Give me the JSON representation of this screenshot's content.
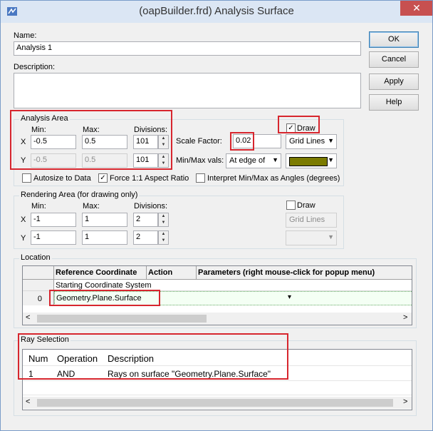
{
  "window": {
    "title": "(oapBuilder.frd) Analysis Surface",
    "close_glyph": "✕"
  },
  "name": {
    "label": "Name:",
    "value": "Analysis 1"
  },
  "description": {
    "label": "Description:",
    "value": ""
  },
  "buttons": {
    "ok": "OK",
    "cancel": "Cancel",
    "apply": "Apply",
    "help": "Help"
  },
  "analysis_area": {
    "title": "Analysis Area",
    "min_label": "Min:",
    "max_label": "Max:",
    "div_label": "Divisions:",
    "x_label": "X",
    "y_label": "Y",
    "x_min": "-0.5",
    "x_max": "0.5",
    "x_div": "101",
    "y_min": "-0.5",
    "y_max": "0.5",
    "y_div": "101",
    "draw_label": "Draw",
    "scale_label": "Scale Factor:",
    "scale_value": "0.02",
    "grid_lines": "Grid Lines",
    "minmax_label": "Min/Max vals:",
    "minmax_value": "At edge of",
    "color_swatch": "#7b7b00",
    "autosize": "Autosize to Data",
    "force_aspect": "Force 1:1 Aspect Ratio",
    "interpret": "Interpret Min/Max as Angles (degrees)"
  },
  "rendering_area": {
    "title": "Rendering Area (for drawing only)",
    "min_label": "Min:",
    "max_label": "Max:",
    "div_label": "Divisions:",
    "x_label": "X",
    "y_label": "Y",
    "x_min": "-1",
    "x_max": "1",
    "x_div": "2",
    "y_min": "-1",
    "y_max": "1",
    "y_div": "2",
    "draw_label": "Draw",
    "grid_lines": "Grid Lines"
  },
  "location": {
    "title": "Location",
    "headers": [
      "Reference Coordinate",
      "Action",
      "Parameters (right mouse-click for popup menu)"
    ],
    "row_label_first": "Starting Coordinate System",
    "row_index": "0",
    "row_value": "Geometry.Plane.Surface"
  },
  "ray_selection": {
    "title": "Ray Selection",
    "headers": [
      "Num",
      "Operation",
      "Description"
    ],
    "rows": [
      {
        "num": "1",
        "operation": "AND",
        "description": "Rays on surface \"Geometry.Plane.Surface\""
      }
    ]
  },
  "scroll": {
    "left": "<",
    "right": ">"
  },
  "highlight_color": "#d7262e"
}
